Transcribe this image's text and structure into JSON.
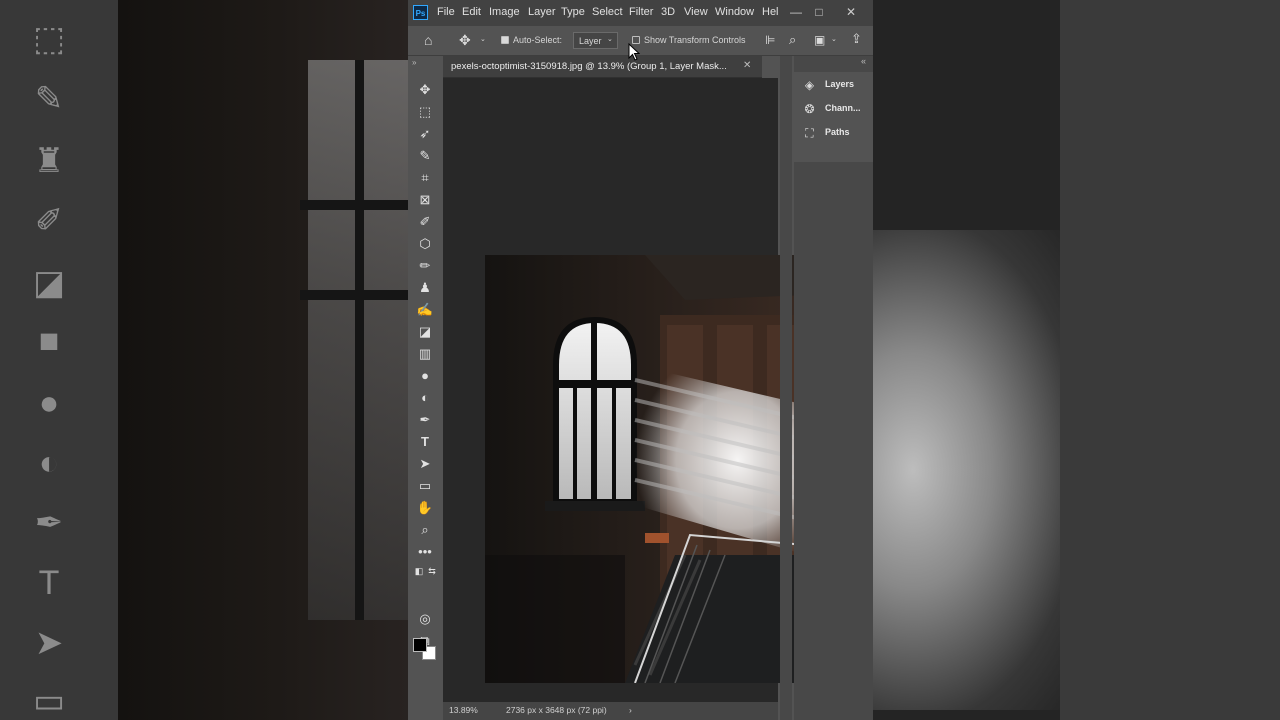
{
  "app": {
    "logo_text": "Ps",
    "menu": [
      "File",
      "Edit",
      "Image",
      "Layer",
      "Type",
      "Select",
      "Filter",
      "3D",
      "View",
      "Window",
      "Hel"
    ]
  },
  "window_controls": {
    "minimize": "—",
    "maximize": "□",
    "close": "✕"
  },
  "options_bar": {
    "auto_select_label": "Auto-Select:",
    "auto_select_checked": true,
    "auto_select_target": "Layer",
    "show_transform_label": "Show Transform Controls",
    "show_transform_checked": false
  },
  "document": {
    "tab_title": "pexels-octoptimist-3150918.jpg @ 13.9% (Group 1, Layer Mask...",
    "close": "✕"
  },
  "status_bar": {
    "zoom": "13.89%",
    "doc_info": "2736 px x 3648 px (72 ppi)",
    "arrow": "›"
  },
  "panels": {
    "items": [
      {
        "label": "Layers",
        "icon": "layers-icon"
      },
      {
        "label": "Chann...",
        "icon": "channels-icon"
      },
      {
        "label": "Paths",
        "icon": "paths-icon"
      }
    ]
  },
  "tools": [
    "move-tool-icon",
    "marquee-tool-icon",
    "lasso-tool-icon",
    "quick-selection-icon",
    "crop-tool-icon",
    "frame-tool-icon",
    "eyedropper-icon",
    "healing-brush-icon",
    "brush-tool-icon",
    "clone-stamp-icon",
    "history-brush-icon",
    "eraser-icon",
    "gradient-tool-icon",
    "blur-tool-icon",
    "dodge-tool-icon",
    "pen-tool-icon",
    "type-tool-icon",
    "path-selection-icon",
    "rectangle-tool-icon",
    "hand-tool-icon",
    "zoom-tool-icon",
    "more-tools-icon"
  ],
  "colors": {
    "foreground": "#000000",
    "background": "#ffffff",
    "ui_dark": "#535353",
    "menubar": "#424242",
    "canvas_bg": "#282828",
    "accent_ps": "#31a8ff"
  }
}
